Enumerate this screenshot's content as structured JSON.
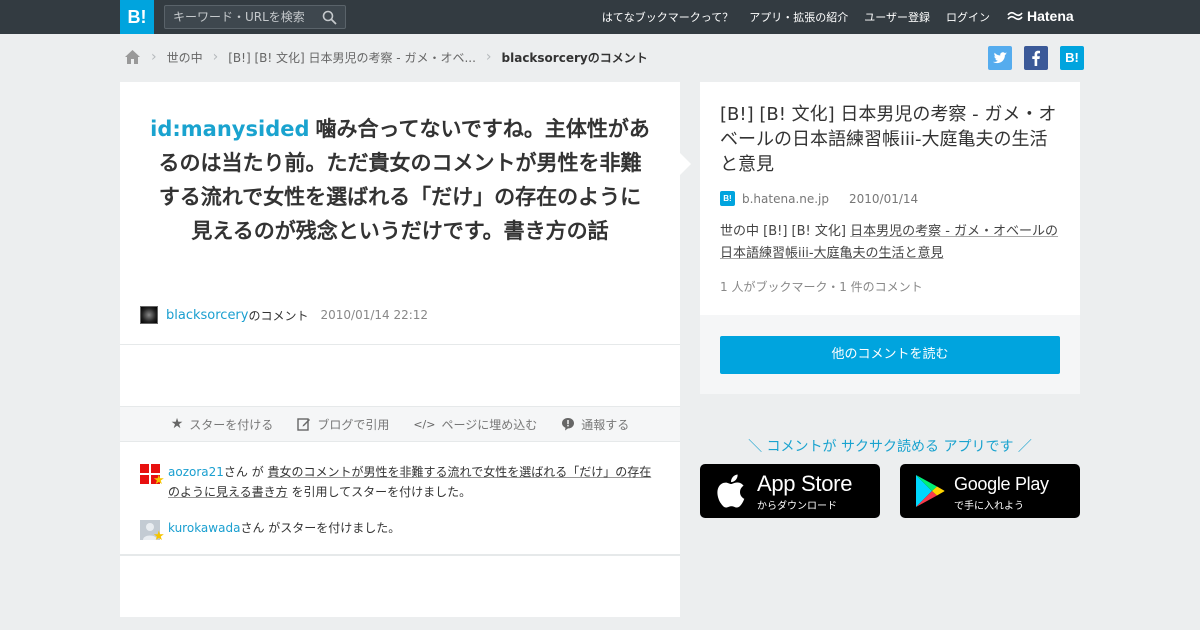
{
  "header": {
    "logo": "B!",
    "search_placeholder": "キーワード・URLを検索",
    "nav": [
      "はてなブックマークって？",
      "アプリ・拡張の紹介",
      "ユーザー登録",
      "ログイン"
    ],
    "brand": "Hatena"
  },
  "breadcrumb": {
    "items": [
      "世の中",
      "[B!] [B! 文化] 日本男児の考察 - ガメ・オベ..."
    ],
    "current": "blacksorceryのコメント"
  },
  "social": {
    "twitter": "t",
    "facebook": "f",
    "hatebu": "B!"
  },
  "comment": {
    "user_id": "id:manysided",
    "text": "噛み合ってないですね。主体性があるのは当たり前。ただ貴女のコメントが男性を非難する流れで女性を選ばれる「だけ」の存在のように見えるのが残念というだけです。書き方の話",
    "author": "blacksorcery",
    "author_suffix": "のコメント",
    "date": "2010/01/14 22:12"
  },
  "actions": {
    "star": "スターを付ける",
    "blog": "ブログで引用",
    "embed": "ページに埋め込む",
    "report": "通報する"
  },
  "stars": [
    {
      "user": "aozora21",
      "pre": "さん が ",
      "quote": "貴女のコメントが男性を非難する流れで女性を選ばれる「だけ」の存在のように見える書き方",
      "post": " を引用してスターを付けました。"
    },
    {
      "user": "kurokawada",
      "pre": "さん がスターを付けました。"
    }
  ],
  "entry": {
    "title": "[B!] [B! 文化] 日本男児の考察 - ガメ・オベールの日本語練習帳iii-大庭亀夫の生活と意見",
    "site": "b.hatena.ne.jp",
    "site_icon": "B!",
    "date": "2010/01/14",
    "desc_category": "世の中",
    "desc_prefix": " [B!] [B! 文化] ",
    "desc_link": "日本男児の考察 - ガメ・オベールの日本語練習帳iii-大庭亀夫の生活と意見",
    "count": "1 人がブックマーク・1 件のコメント",
    "more_button": "他のコメントを読む"
  },
  "promo": {
    "tagline": "＼ コメントが サクサク読める アプリです ／",
    "appstore_big": "App Store",
    "appstore_small": "からダウンロード",
    "googleplay_big": "Google Play",
    "googleplay_small": "で手に入れよう"
  }
}
